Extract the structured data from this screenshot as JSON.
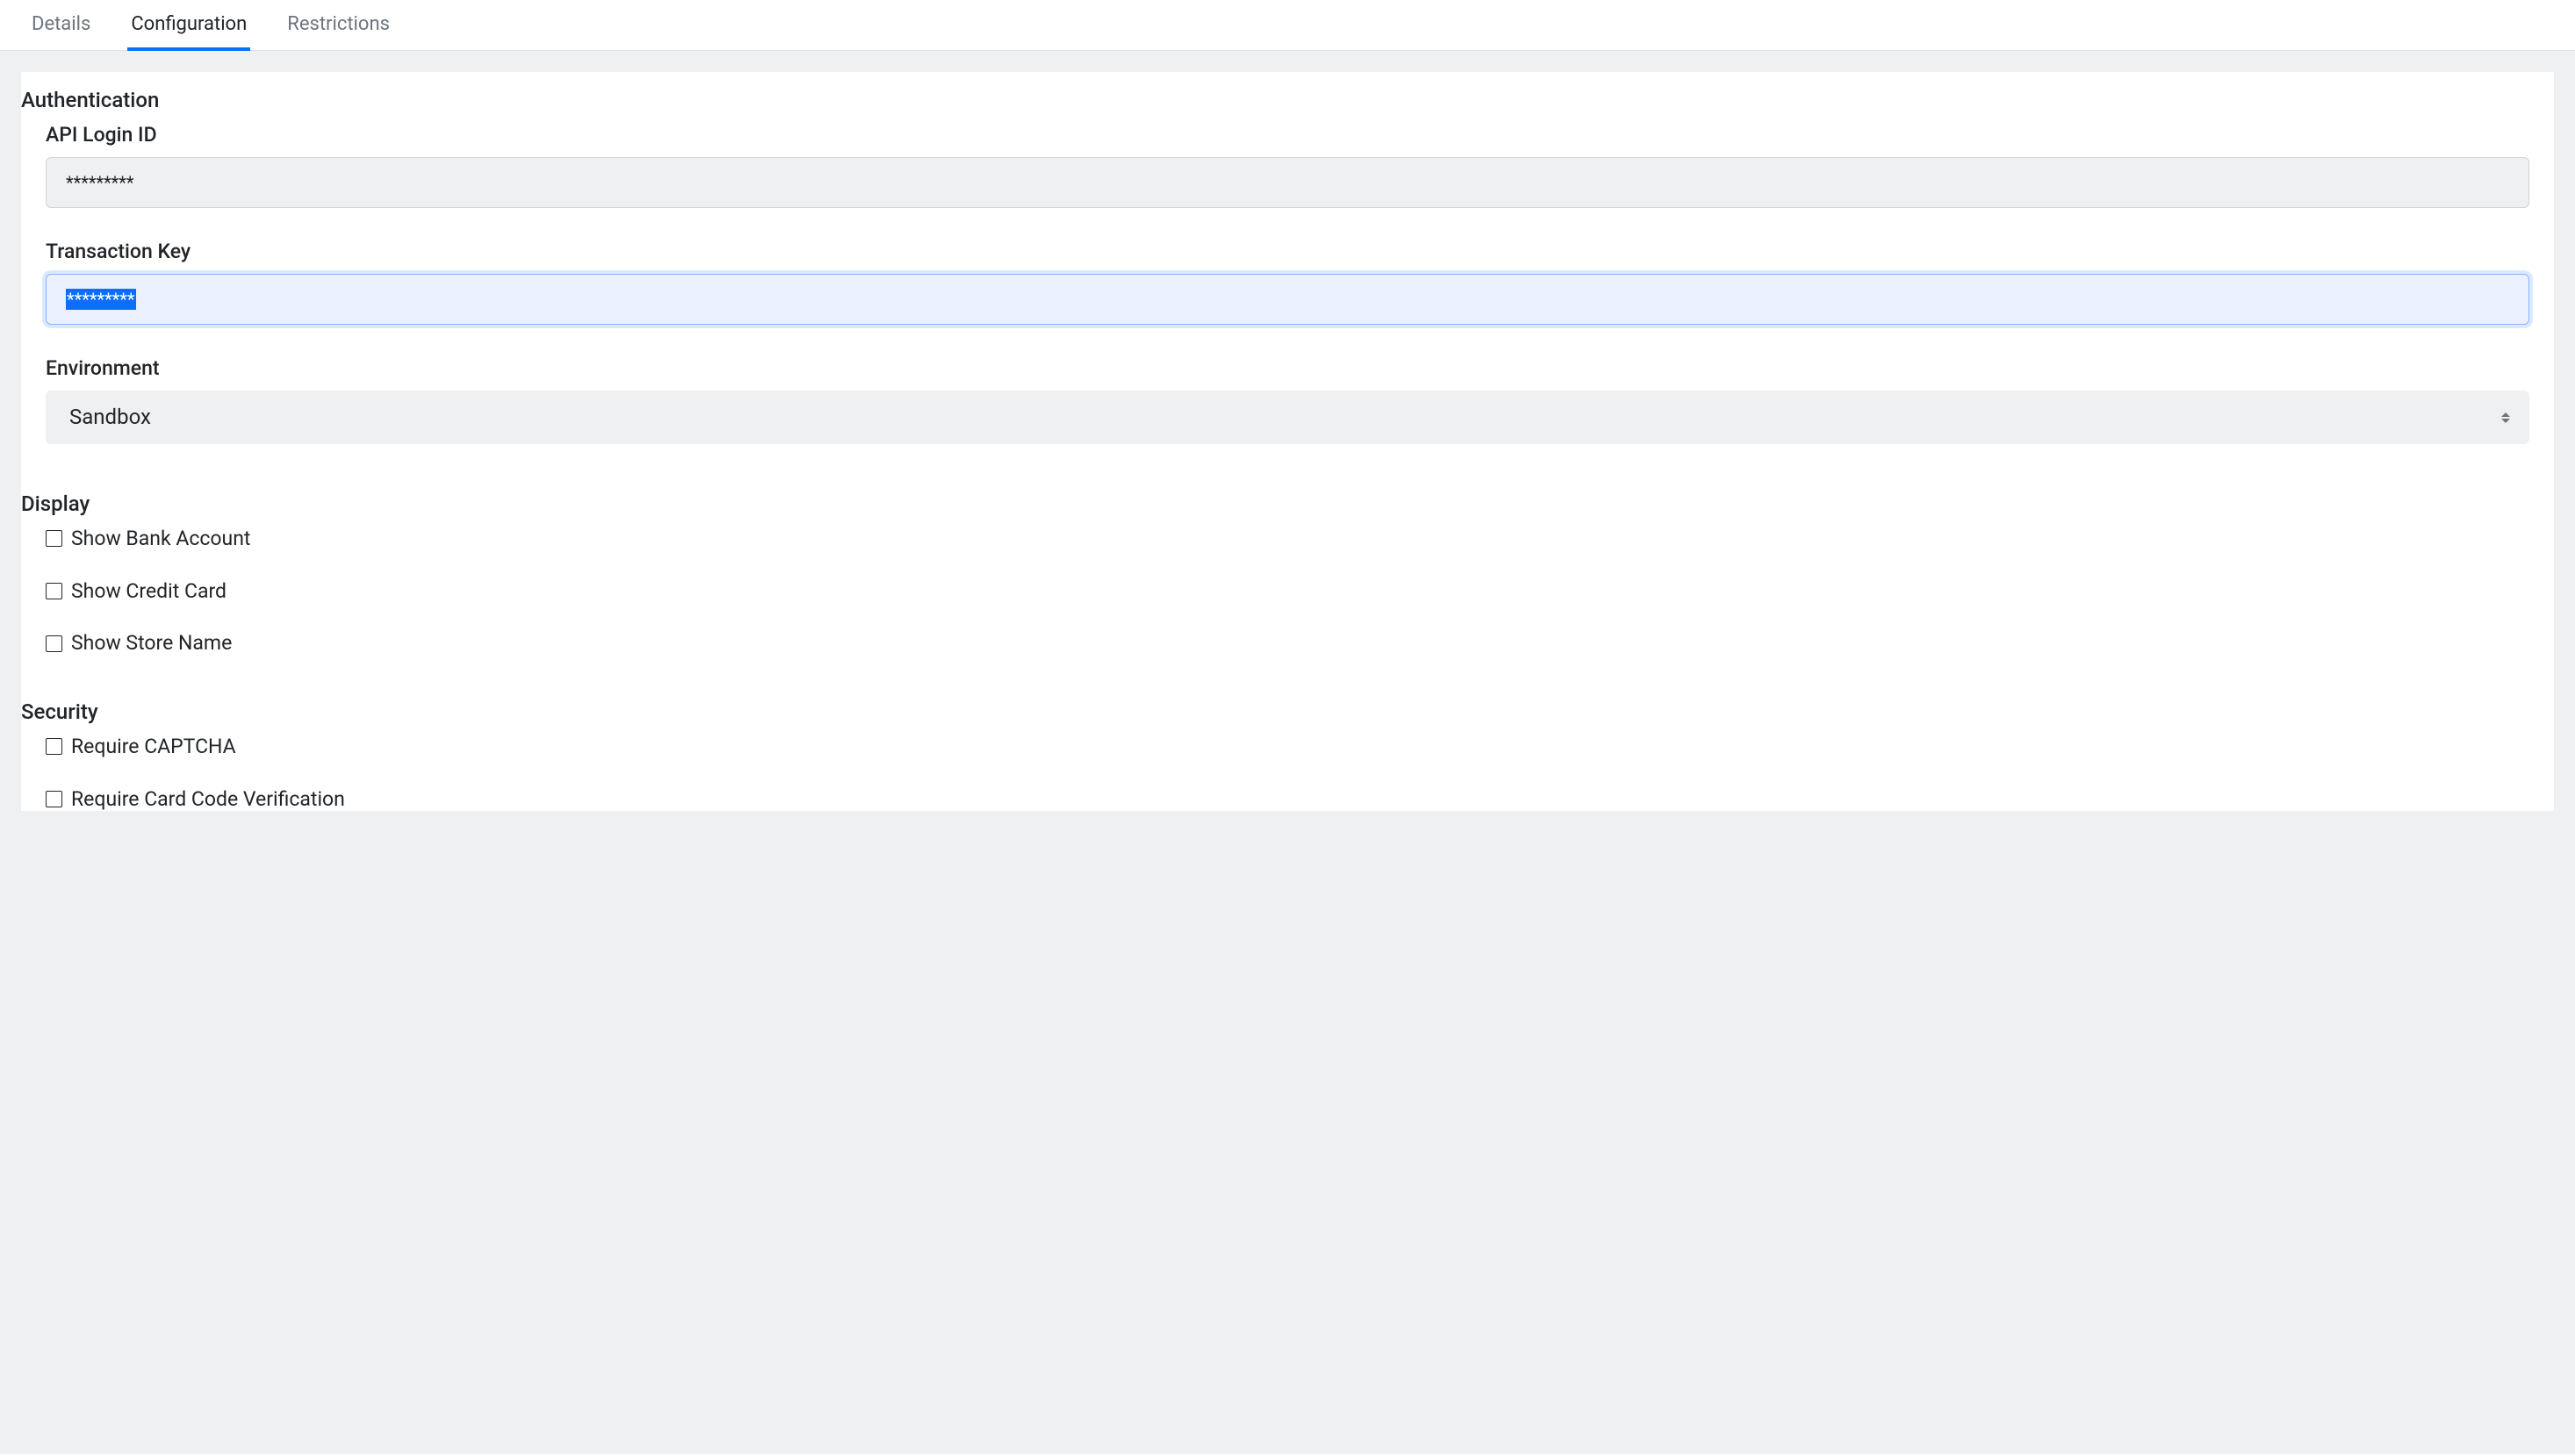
{
  "tabs": {
    "details": "Details",
    "configuration": "Configuration",
    "restrictions": "Restrictions"
  },
  "sections": {
    "authentication": {
      "heading": "Authentication",
      "fields": {
        "api_login_id": {
          "label": "API Login ID",
          "value": "*********"
        },
        "transaction_key": {
          "label": "Transaction Key",
          "value": "*********"
        },
        "environment": {
          "label": "Environment",
          "value": "Sandbox"
        }
      }
    },
    "display": {
      "heading": "Display",
      "options": {
        "show_bank_account": "Show Bank Account",
        "show_credit_card": "Show Credit Card",
        "show_store_name": "Show Store Name"
      }
    },
    "security": {
      "heading": "Security",
      "options": {
        "require_captcha": "Require CAPTCHA",
        "require_cvv": "Require Card Code Verification"
      }
    }
  }
}
